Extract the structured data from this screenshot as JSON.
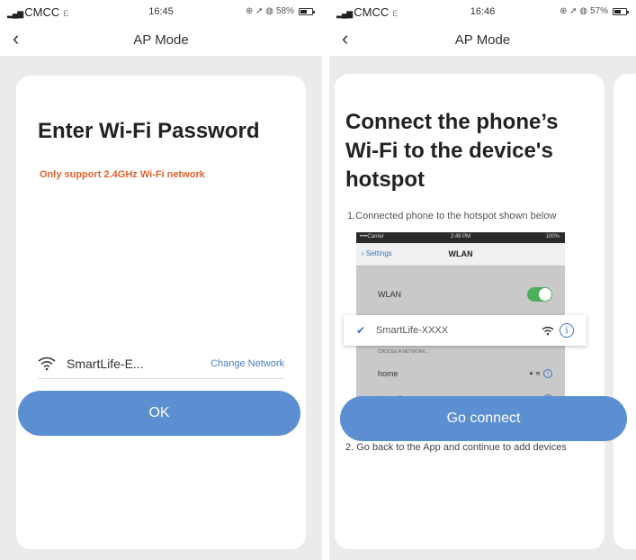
{
  "left": {
    "status": {
      "carrier": "CMCC",
      "network": "E",
      "time": "16:45",
      "battery": "58%",
      "battery_level": 0.58
    },
    "nav": {
      "back_icon": "chevron-left-icon",
      "title": "AP Mode"
    },
    "card": {
      "title": "Enter Wi-Fi Password",
      "warning": "Only support 2.4GHz Wi-Fi network",
      "ssid": "SmartLife-E...",
      "change_network": "Change Network",
      "password_mask": "•••••••••",
      "ok_label": "OK"
    },
    "colors": {
      "accent": "#5b8fd1",
      "warning": "#e0622f",
      "link": "#4a7ec0"
    }
  },
  "right": {
    "status": {
      "carrier": "CMCC",
      "network": "E",
      "time": "16:46",
      "battery": "57%",
      "battery_level": 0.57
    },
    "nav": {
      "back_icon": "chevron-left-icon",
      "title": "AP Mode"
    },
    "card": {
      "title": "Connect the phone’s Wi-Fi to the device's hotspot",
      "step1": "1.Connected phone to the hotspot shown below",
      "step2": "2. Go back to the App and continue to add devices",
      "go_connect_label": "Go connect",
      "example": {
        "status_carrier": "••••Carrier",
        "status_time": "2:49 PM",
        "status_battery": "100%",
        "back_label": "Settings",
        "title": "WLAN",
        "wlan_label": "WLAN",
        "hotspot_name": "SmartLife-XXXX",
        "section_label": "CHOOSE A NETWORK...",
        "networks": [
          "home",
          "home2"
        ]
      }
    }
  }
}
